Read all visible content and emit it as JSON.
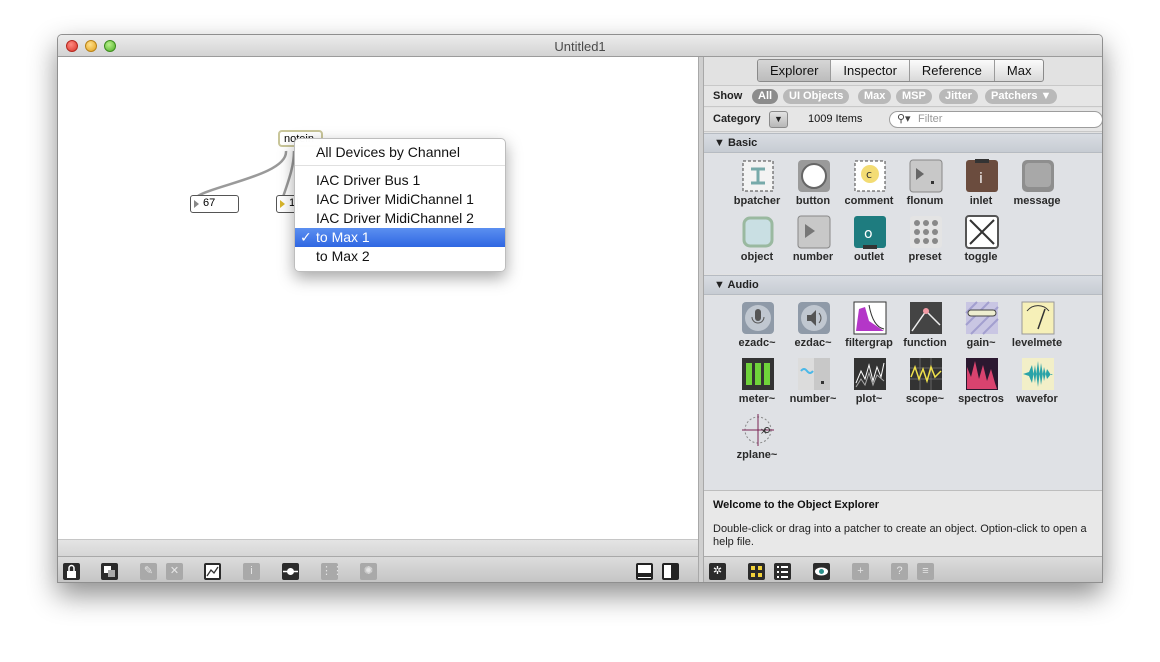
{
  "window": {
    "title": "Untitled1"
  },
  "patcher": {
    "objects": {
      "notein": "notein",
      "number_left": "67",
      "number_right": "1"
    },
    "popup_menu": {
      "items": [
        "All Devices by Channel",
        "IAC Driver Bus 1",
        "IAC Driver MidiChannel 1",
        "IAC Driver MidiChannel 2",
        "to Max 1",
        "to Max 2"
      ],
      "selected": "to Max 1",
      "check": "✓"
    }
  },
  "explorer": {
    "tabs": [
      "Explorer",
      "Inspector",
      "Reference",
      "Max"
    ],
    "active_tab": "Explorer",
    "show_label": "Show",
    "filters": [
      "All",
      "UI Objects",
      "Max",
      "MSP",
      "Jitter",
      "Patchers ▼"
    ],
    "active_filter": "All",
    "category_label": "Category",
    "category_button": "▼",
    "item_count": "1009 Items",
    "filter_placeholder": "Filter",
    "sections": {
      "basic": {
        "header": "▼  Basic",
        "items": [
          "bpatcher",
          "button",
          "comment",
          "flonum",
          "inlet",
          "message",
          "object",
          "number",
          "outlet",
          "preset",
          "toggle"
        ]
      },
      "audio": {
        "header": "▼  Audio",
        "items": [
          "ezadc~",
          "ezdac~",
          "filtergrap",
          "function",
          "gain~",
          "levelmete",
          "meter~",
          "number~",
          "plot~",
          "scope~",
          "spectros",
          "wavefor",
          "zplane~"
        ]
      }
    },
    "welcome": {
      "title": "Welcome to the Object Explorer",
      "text": "Double-click or drag into a patcher to create an object. Option-click to open a help file."
    }
  }
}
